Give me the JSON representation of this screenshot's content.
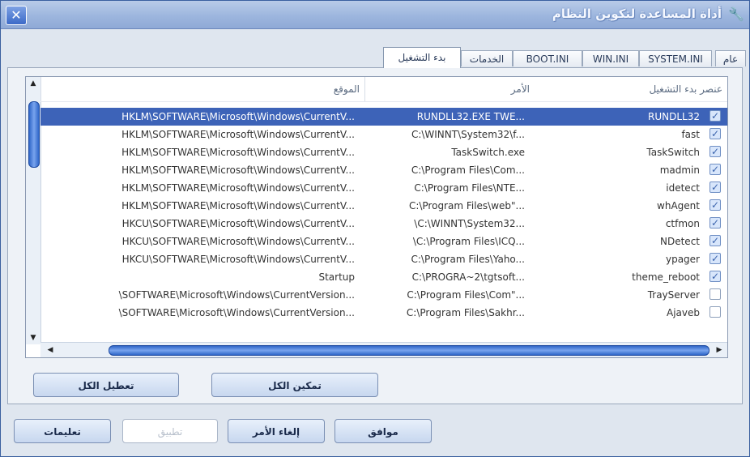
{
  "window": {
    "title": "أداة المساعدة لتكوين النظام",
    "close_glyph": "✕",
    "app_icon": "wrench-icon"
  },
  "tabs": [
    {
      "label": "عام"
    },
    {
      "label": "SYSTEM.INI"
    },
    {
      "label": "WIN.INI"
    },
    {
      "label": "BOOT.INI"
    },
    {
      "label": "الخدمات"
    },
    {
      "label": "بدء التشغيل",
      "active": true
    }
  ],
  "columns": {
    "name": "عنصر بدء التشغيل",
    "command": "الأمر",
    "location": "الموقع"
  },
  "rows": [
    {
      "checked": true,
      "name": "RUNDLL32",
      "command": "RUNDLL32.EXE TWE...",
      "location": "HKLM\\SOFTWARE\\Microsoft\\Windows\\CurrentV...",
      "selected": true
    },
    {
      "checked": true,
      "name": "fast",
      "command": "C:\\WINNT\\System32\\f...",
      "location": "HKLM\\SOFTWARE\\Microsoft\\Windows\\CurrentV..."
    },
    {
      "checked": true,
      "name": "TaskSwitch",
      "command": "TaskSwitch.exe",
      "location": "HKLM\\SOFTWARE\\Microsoft\\Windows\\CurrentV..."
    },
    {
      "checked": true,
      "name": "madmin",
      "command": "C:\\Program Files\\Com...",
      "location": "HKLM\\SOFTWARE\\Microsoft\\Windows\\CurrentV..."
    },
    {
      "checked": true,
      "name": "idetect",
      "command": "C:\\Program Files\\NTE...",
      "location": "HKLM\\SOFTWARE\\Microsoft\\Windows\\CurrentV..."
    },
    {
      "checked": true,
      "name": "whAgent",
      "command": "C:\\Program Files\\web\"...",
      "location": "HKLM\\SOFTWARE\\Microsoft\\Windows\\CurrentV..."
    },
    {
      "checked": true,
      "name": "ctfmon",
      "command": "\\C:\\WINNT\\System32...",
      "location": "HKCU\\SOFTWARE\\Microsoft\\Windows\\CurrentV..."
    },
    {
      "checked": true,
      "name": "NDetect",
      "command": "\\C:\\Program Files\\ICQ...",
      "location": "HKCU\\SOFTWARE\\Microsoft\\Windows\\CurrentV..."
    },
    {
      "checked": true,
      "name": "ypager",
      "command": "C:\\Program Files\\Yaho...",
      "location": "HKCU\\SOFTWARE\\Microsoft\\Windows\\CurrentV..."
    },
    {
      "checked": true,
      "name": "theme_reboot",
      "command": "C:\\PROGRA~2\\tgtsoft...",
      "location": "Startup"
    },
    {
      "checked": false,
      "name": "TrayServer",
      "command": "C:\\Program Files\\Com\"...",
      "location": "\\SOFTWARE\\Microsoft\\Windows\\CurrentVersion..."
    },
    {
      "checked": false,
      "name": "Ajaveb",
      "command": "C:\\Program Files\\Sakhr...",
      "location": "\\SOFTWARE\\Microsoft\\Windows\\CurrentVersion..."
    }
  ],
  "buttons": {
    "disable_all": "تعطيل الكل",
    "enable_all": "تمكين الكل",
    "help": "تعليمات",
    "apply": "تطبيق",
    "cancel": "إلغاء الأمر",
    "ok": "موافق"
  },
  "scroll": {
    "up": "▲",
    "down": "▼",
    "left": "◀",
    "right": "▶"
  }
}
